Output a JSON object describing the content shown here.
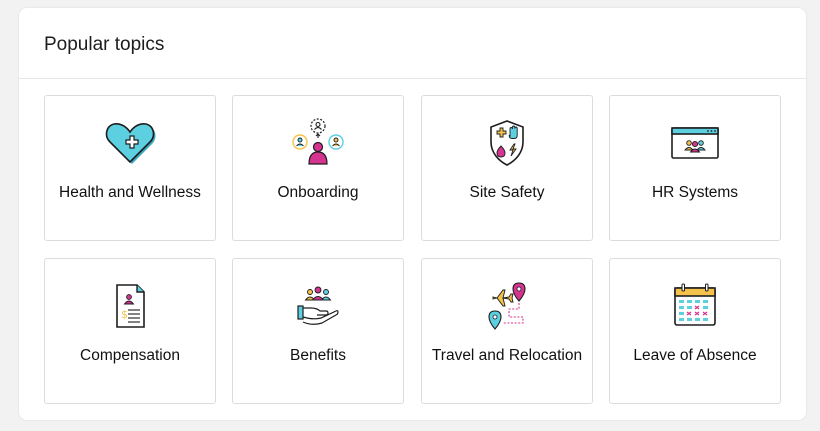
{
  "title": "Popular topics",
  "topics": [
    {
      "label": "Health and Wellness",
      "icon": "heart-health-icon"
    },
    {
      "label": "Onboarding",
      "icon": "onboarding-people-icon"
    },
    {
      "label": "Site Safety",
      "icon": "safety-shield-icon"
    },
    {
      "label": "HR Systems",
      "icon": "hr-systems-window-icon"
    },
    {
      "label": "Compensation",
      "icon": "compensation-document-icon"
    },
    {
      "label": "Benefits",
      "icon": "benefits-hand-people-icon"
    },
    {
      "label": "Travel and Relocation",
      "icon": "travel-plane-pin-icon"
    },
    {
      "label": "Leave of Absence",
      "icon": "calendar-icon"
    }
  ],
  "colors": {
    "teal": "#5ccfe0",
    "magenta": "#d4338f",
    "yellow": "#f4c24a",
    "outline": "#1d1d1f"
  }
}
